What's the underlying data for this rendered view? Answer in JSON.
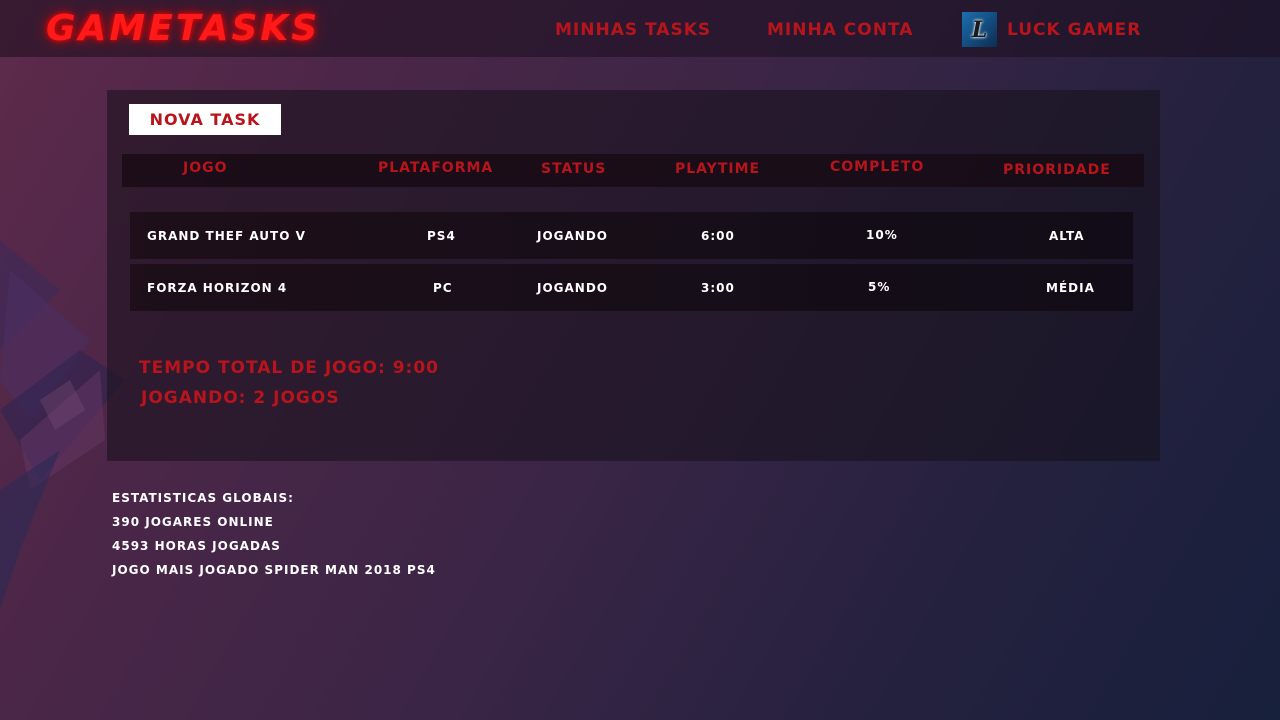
{
  "header": {
    "logo": "GAMETASKS",
    "nav": {
      "my_tasks": "MINHAS TASKS",
      "my_account": "MINHA CONTA",
      "user_name": "LUCK GAMER"
    }
  },
  "panel": {
    "new_task_label": "NOVA TASK",
    "columns": [
      "JOGO",
      "PLATAFORMA",
      "STATUS",
      "PLAYTIME",
      "COMPLETO",
      "PRIORIDADE"
    ],
    "rows": [
      {
        "game": "GRAND THEF AUTO V",
        "platform": "PS4",
        "status": "JOGANDO",
        "playtime": "6:00",
        "complete": "10%",
        "priority": "ALTA"
      },
      {
        "game": "FORZA HORIZON 4",
        "platform": "PC",
        "status": "JOGANDO",
        "playtime": "3:00",
        "complete": "5%",
        "priority": "MÉDIA"
      }
    ],
    "summary": {
      "total_time": "TEMPO TOTAL DE JOGO: 9:00",
      "playing": "JOGANDO: 2 JOGOS"
    }
  },
  "global_stats": {
    "title": "ESTATISTICAS GLOBAIS:",
    "online": "390 JOGARES ONLINE",
    "hours": "4593 HORAS JOGADAS",
    "most_played": "JOGO MAIS JOGADO SPIDER MAN 2018 PS4"
  },
  "colors": {
    "accent_red": "#b8141c",
    "logo_red": "#ff1a1a",
    "text_white": "#ffffff"
  }
}
